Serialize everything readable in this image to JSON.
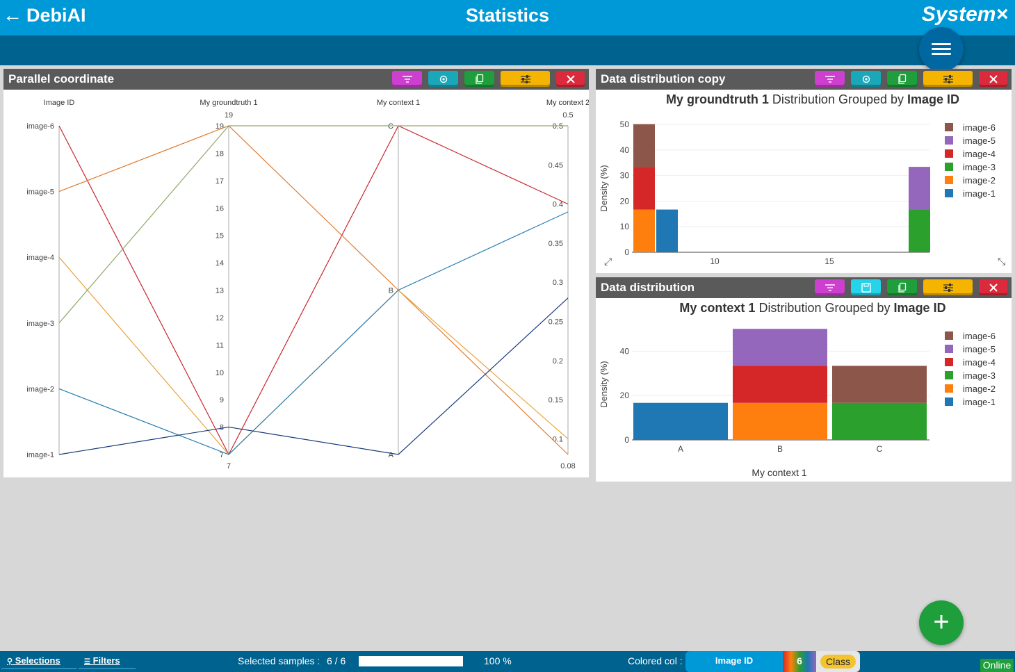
{
  "header": {
    "back_label": "←",
    "app_name": "DebiAI",
    "title": "Statistics",
    "brand": "System×"
  },
  "panels": {
    "parallel": {
      "title": "Parallel coordinate",
      "axes": [
        "Image ID",
        "My groundtruth 1",
        "My context 1",
        "My context 2"
      ],
      "id_ticks": [
        "image-6",
        "image-5",
        "image-4",
        "image-3",
        "image-2",
        "image-1"
      ],
      "gt_ticks": [
        "19",
        "18",
        "17",
        "16",
        "15",
        "14",
        "13",
        "12",
        "11",
        "10",
        "9",
        "8",
        "7"
      ],
      "gt_top": "19",
      "gt_bottom": "7",
      "ctx1_ticks": [
        "C",
        "B",
        "A"
      ],
      "ctx2_ticks": [
        "0.5",
        "0.45",
        "0.4",
        "0.35",
        "0.3",
        "0.25",
        "0.2",
        "0.15",
        "0.1"
      ],
      "ctx2_top": "0.5",
      "ctx2_bottom": "0.08",
      "lines": [
        {
          "id": "image-6",
          "gt": 7,
          "ctx1": "C",
          "ctx2": 0.4,
          "color": "#c8262e"
        },
        {
          "id": "image-5",
          "gt": 19,
          "ctx1": "B",
          "ctx2": 0.08,
          "color": "#e07b2f"
        },
        {
          "id": "image-4",
          "gt": 7,
          "ctx1": "B",
          "ctx2": 0.1,
          "color": "#e8a33a"
        },
        {
          "id": "image-3",
          "gt": 19,
          "ctx1": "C",
          "ctx2": 0.5,
          "color": "#8fa868"
        },
        {
          "id": "image-2",
          "gt": 7,
          "ctx1": "B",
          "ctx2": 0.39,
          "color": "#2a7fb3"
        },
        {
          "id": "image-1",
          "gt": 8,
          "ctx1": "A",
          "ctx2": 0.28,
          "color": "#17397a"
        }
      ]
    },
    "dist_copy": {
      "title": "Data distribution copy",
      "heading_bold1": "My groundtruth 1",
      "heading_mid": "Distribution Grouped by",
      "heading_bold2": "Image ID",
      "ylabel": "Density (%)",
      "xticks": [
        "10",
        "15"
      ],
      "yticks": [
        "0",
        "10",
        "20",
        "30",
        "40",
        "50"
      ]
    },
    "dist": {
      "title": "Data distribution",
      "heading_bold1": "My context 1",
      "heading_mid": "Distribution Grouped by",
      "heading_bold2": "Image ID",
      "ylabel": "Density (%)",
      "xlabel": "My context 1",
      "yticks": [
        "0",
        "20",
        "40"
      ]
    }
  },
  "legend": [
    "image-6",
    "image-5",
    "image-4",
    "image-3",
    "image-2",
    "image-1"
  ],
  "colors": {
    "image-6": "#8c564b",
    "image-5": "#9467bd",
    "image-4": "#d62728",
    "image-3": "#2ca02c",
    "image-2": "#ff7f0e",
    "image-1": "#1f77b4"
  },
  "chart_data": [
    {
      "type": "bar",
      "title": "My groundtruth 1 Distribution Grouped by Image ID",
      "ylabel": "Density (%)",
      "ylim": [
        0,
        50
      ],
      "stacked": true,
      "x": [
        7,
        8,
        19
      ],
      "series": [
        {
          "name": "image-1",
          "values": [
            0,
            16.7,
            0
          ]
        },
        {
          "name": "image-2",
          "values": [
            16.7,
            0,
            0
          ]
        },
        {
          "name": "image-3",
          "values": [
            0,
            0,
            16.7
          ]
        },
        {
          "name": "image-4",
          "values": [
            16.7,
            0,
            0
          ]
        },
        {
          "name": "image-5",
          "values": [
            0,
            0,
            16.7
          ]
        },
        {
          "name": "image-6",
          "values": [
            16.7,
            0,
            0
          ]
        }
      ]
    },
    {
      "type": "bar",
      "title": "My context 1 Distribution Grouped by Image ID",
      "xlabel": "My context 1",
      "ylabel": "Density (%)",
      "stacked": true,
      "categories": [
        "A",
        "B",
        "C"
      ],
      "series": [
        {
          "name": "image-1",
          "values": [
            16.7,
            0,
            0
          ]
        },
        {
          "name": "image-2",
          "values": [
            0,
            16.7,
            0
          ]
        },
        {
          "name": "image-3",
          "values": [
            0,
            0,
            16.7
          ]
        },
        {
          "name": "image-4",
          "values": [
            0,
            16.7,
            0
          ]
        },
        {
          "name": "image-5",
          "values": [
            0,
            16.7,
            0
          ]
        },
        {
          "name": "image-6",
          "values": [
            0,
            0,
            16.7
          ]
        }
      ]
    }
  ],
  "footer": {
    "selections": "Selections",
    "filters": "Filters",
    "selected_label": "Selected samples :",
    "selected_value": "6 / 6",
    "progress_value": 1.0,
    "progress_pct": "100 %",
    "colored_label": "Colored col :",
    "colored_value": "Image ID",
    "colored_count": "6",
    "class_label": "Class",
    "online": "Online"
  }
}
